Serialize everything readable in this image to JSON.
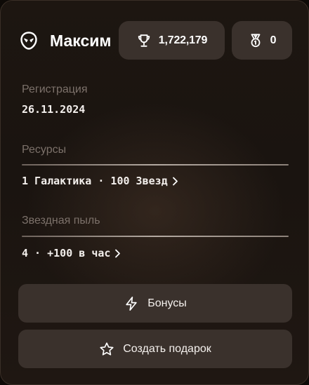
{
  "profile": {
    "user_icon": "alien-face-icon",
    "name": "Максим"
  },
  "stats": {
    "trophies": {
      "icon": "trophy-icon",
      "value": "1,722,179"
    },
    "medals": {
      "icon": "medal-icon",
      "value": "0"
    }
  },
  "registration": {
    "label": "Регистрация",
    "value": "26.11.2024"
  },
  "resources": {
    "label": "Ресурсы",
    "value": "1 Галактика · 100 Звезд"
  },
  "stardust": {
    "label": "Звездная пыль",
    "value": "4 · +100 в час"
  },
  "actions": {
    "bonuses": {
      "icon": "lightning-icon",
      "label": "Бонусы"
    },
    "create_gift": {
      "icon": "star-icon",
      "label": "Создать подарок"
    }
  }
}
